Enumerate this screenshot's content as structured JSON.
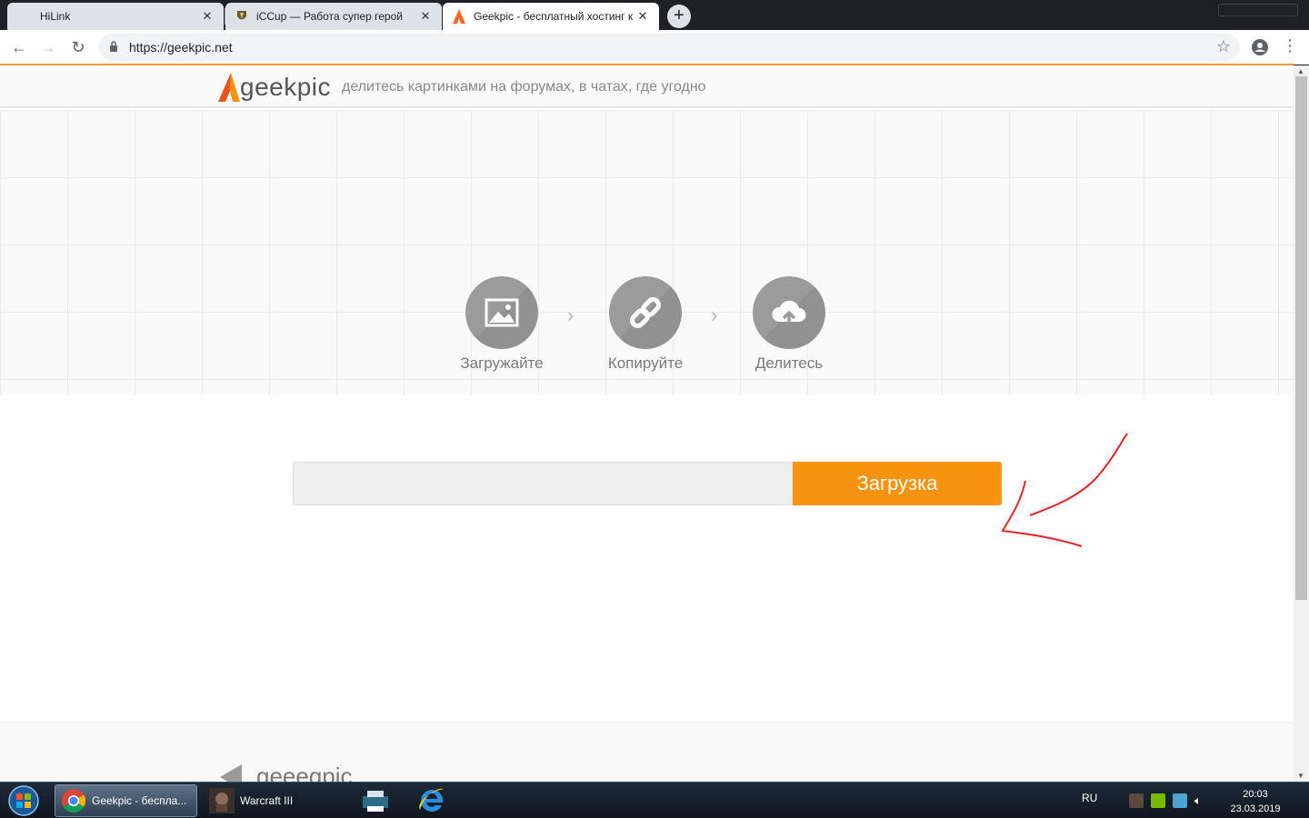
{
  "browser": {
    "tabs": [
      {
        "title": "HiLink"
      },
      {
        "title": "iCCup — Работа супер герой"
      },
      {
        "title": "Geekpic - бесплатный хостинг к"
      }
    ],
    "new_tab": "+",
    "url": "https://geekpic.net"
  },
  "site": {
    "logo": "geekpic",
    "tagline": "делитесь картинками на форумах, в чатах, где угодно",
    "steps": [
      {
        "label": "Загружайте",
        "icon": "image-icon"
      },
      {
        "label": "Копируйте",
        "icon": "link-icon"
      },
      {
        "label": "Делитесь",
        "icon": "cloud-upload-icon"
      }
    ],
    "upload": {
      "field_value": "",
      "button_label": "Загрузка"
    },
    "footer_logo": "geeegpic"
  },
  "taskbar": {
    "items": [
      {
        "label": "Geekpic - бесплa..."
      },
      {
        "label": "Warcraft III"
      }
    ],
    "language": "RU",
    "time": "20:03",
    "date": "23.03.2019"
  },
  "colors": {
    "accent": "#f7930e",
    "annotation": "#e0242a"
  }
}
